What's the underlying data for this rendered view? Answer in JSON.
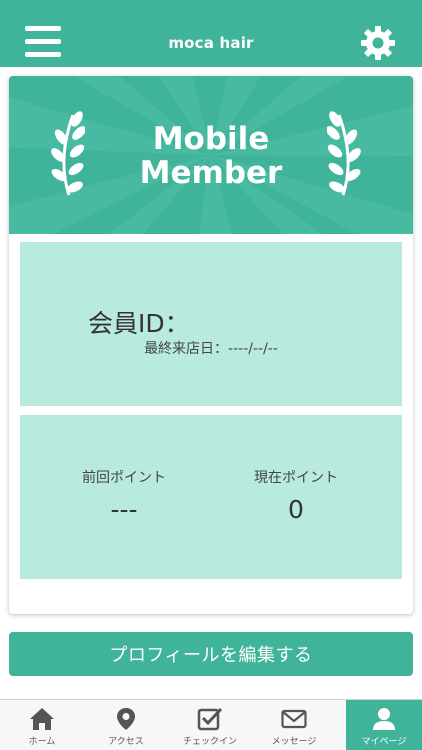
{
  "header": {
    "title": "moca hair",
    "menu_icon": "hamburger-menu-icon",
    "settings_icon": "gear-icon",
    "color": "#3fb49b"
  },
  "card": {
    "banner_title_line1": "Mobile",
    "banner_title_line2": "Member",
    "member_id_label": "会員ID：",
    "last_visit_label": "最終来店日：----/--/--",
    "previous_points_label": "前回ポイント",
    "previous_points_value": "---",
    "current_points_label": "現在ポイント",
    "current_points_value": "0"
  },
  "profile_button_label": "プロフィールを編集する",
  "tabbar": {
    "items": [
      {
        "label": "ホーム",
        "icon": "home-icon"
      },
      {
        "label": "アクセス",
        "icon": "map-pin-icon"
      },
      {
        "label": "チェックイン",
        "icon": "checkbox-icon"
      },
      {
        "label": "メッセージ",
        "icon": "envelope-icon"
      },
      {
        "label": "マイページ",
        "icon": "user-icon"
      }
    ],
    "active_index": 4
  },
  "colors": {
    "accent": "#3fb49b",
    "panel": "#b8ebde"
  }
}
